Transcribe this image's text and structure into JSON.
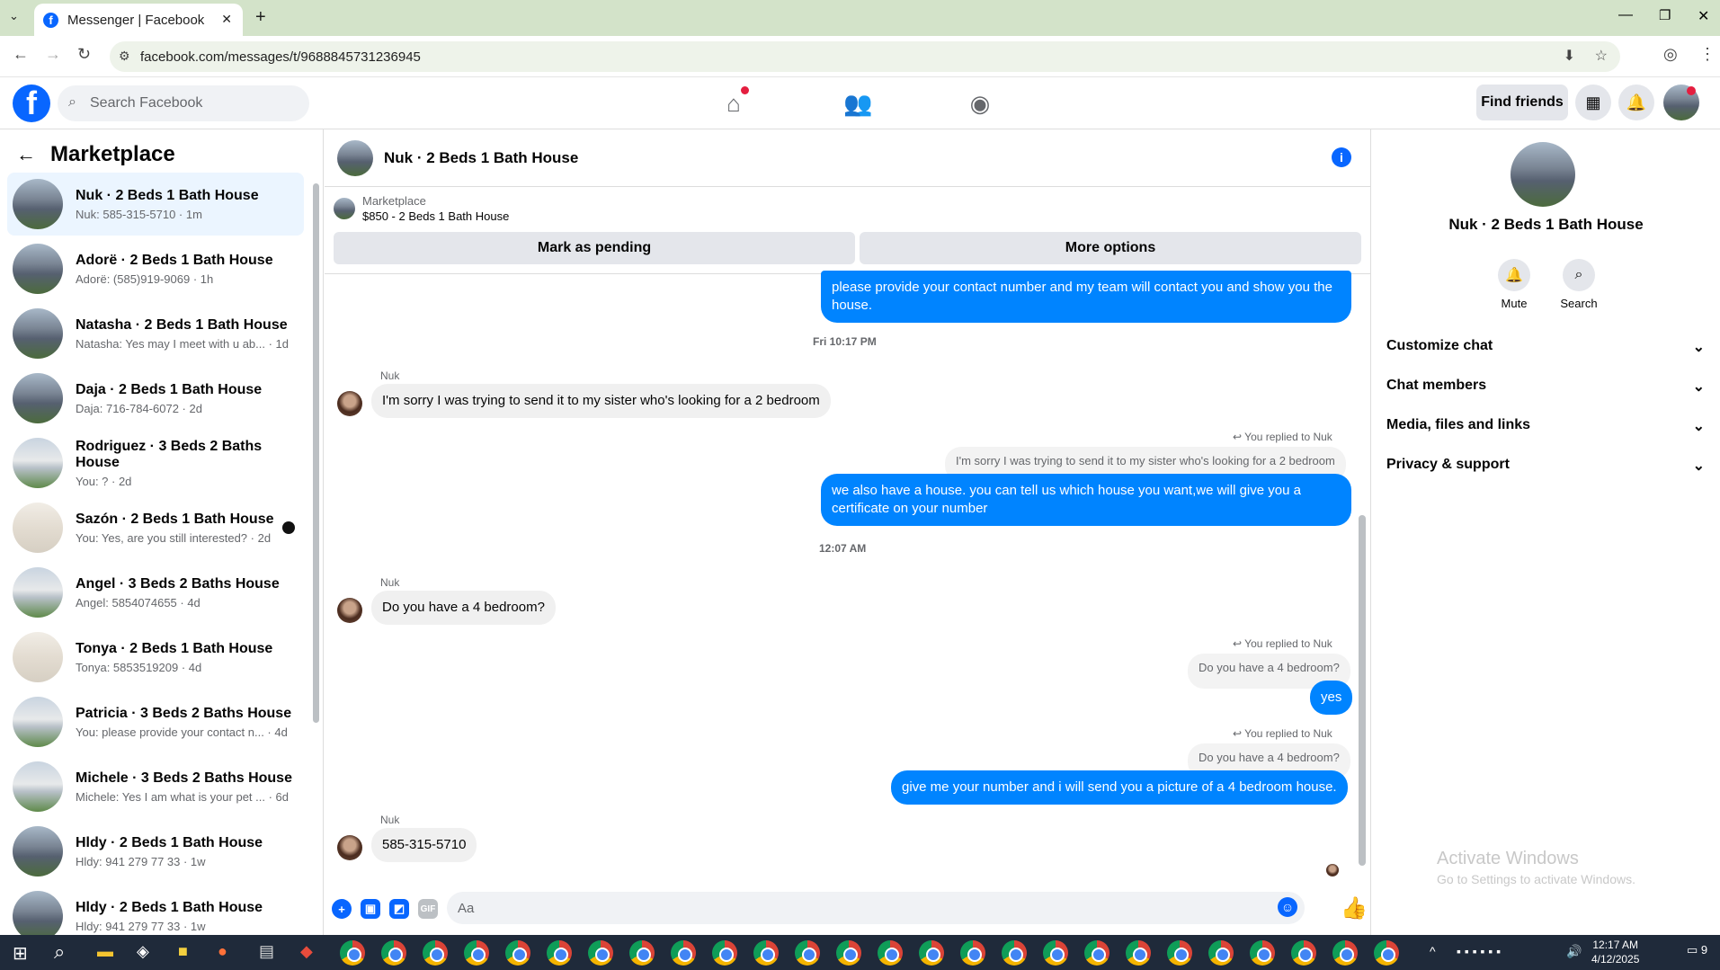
{
  "browser": {
    "tab_title": "Messenger | Facebook",
    "url": "facebook.com/messages/t/9688845731236945"
  },
  "fbnav": {
    "search_placeholder": "Search Facebook",
    "find_friends": "Find friends"
  },
  "sidebar": {
    "title": "Marketplace",
    "conversations": [
      {
        "title": "Nuk · 2 Beds 1 Bath House",
        "sub": "Nuk: 585-315-5710 · 1m"
      },
      {
        "title": "Adorë · 2 Beds 1 Bath House",
        "sub": "Adorë: (585)919-9069 · 1h"
      },
      {
        "title": "Natasha · 2 Beds 1 Bath House",
        "sub": "Natasha: Yes may I meet with u ab... · 1d"
      },
      {
        "title": "Daja · 2 Beds 1 Bath House",
        "sub": "Daja: 716-784-6072 · 2d"
      },
      {
        "title": "Rodriguez · 3 Beds 2 Baths House",
        "sub": "You: ? · 2d"
      },
      {
        "title": "Sazón · 2 Beds 1 Bath House",
        "sub": "You: Yes, are you still interested? · 2d"
      },
      {
        "title": "Angel · 3 Beds 2 Baths House",
        "sub": "Angel: 5854074655 · 4d"
      },
      {
        "title": "Tonya · 2 Beds 1 Bath House",
        "sub": "Tonya: 5853519209 · 4d"
      },
      {
        "title": "Patricia · 3 Beds 2 Baths House",
        "sub": "You: please provide your contact n... · 4d"
      },
      {
        "title": "Michele · 3 Beds 2 Baths House",
        "sub": "Michele: Yes I am what is your pet ... · 6d"
      },
      {
        "title": "Hldy · 2 Beds 1 Bath House",
        "sub": "Hldy: 941 279 77 33 · 1w"
      },
      {
        "title": "Hldy · 2 Beds 1 Bath House",
        "sub": "Hldy: 941 279 77 33 · 1w"
      }
    ]
  },
  "chat": {
    "title": "Nuk · 2 Beds 1 Bath House",
    "marketplace_label": "Marketplace",
    "listing": "$850 - 2 Beds 1 Bath House",
    "mark_pending": "Mark as pending",
    "more_options": "More options",
    "msg1": "please provide your contact number and my team will contact you and show you the house.",
    "stamp1": "Fri 10:17 PM",
    "sender": "Nuk",
    "in1": "I'm sorry I was trying to send it to my sister who's looking for a 2 bedroom",
    "replied": "You replied to Nuk",
    "quote1": "I'm sorry I was trying to send it to my sister who's looking for a 2 bedroom",
    "out2": "we also have a house. you can tell us which house you want,we will give you a certificate on your number",
    "stamp2": "12:07 AM",
    "in2": "Do you have a 4 bedroom?",
    "quote2": "Do you have a 4 bedroom?",
    "out3": "yes",
    "quote3": "Do you have a 4 bedroom?",
    "out4": "give me your number and i will send you a picture of a 4 bedroom house.",
    "in3": "585-315-5710",
    "input_placeholder": "Aa"
  },
  "rpanel": {
    "name": "Nuk · 2 Beds 1 Bath House",
    "mute": "Mute",
    "search": "Search",
    "rows": [
      "Customize chat",
      "Chat members",
      "Media, files and links",
      "Privacy & support"
    ]
  },
  "watermark": {
    "line1": "Activate Windows",
    "line2": "Go to Settings to activate Windows."
  },
  "taskbar": {
    "time": "12:17 AM",
    "date": "4/12/2025",
    "notif": "9"
  }
}
